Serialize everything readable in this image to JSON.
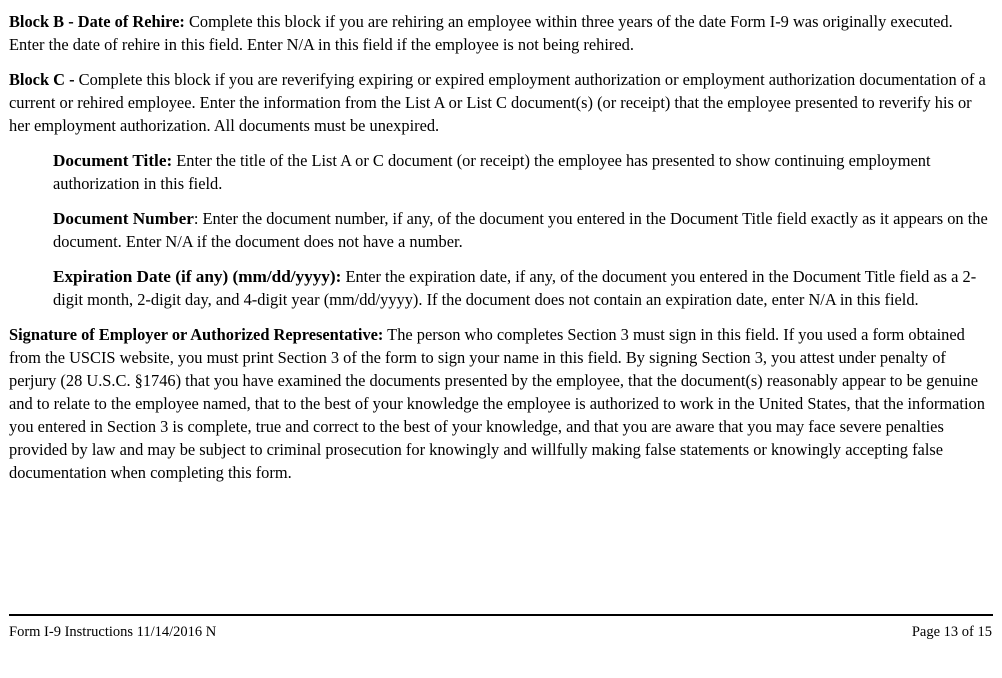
{
  "blocks": {
    "block_b": {
      "heading": "Block B - Date of Rehire:",
      "text": " Complete this block if you are rehiring an employee within three years of the date Form I-9 was originally executed. Enter the date of rehire in this field. Enter N/A in this field if the employee is not being rehired."
    },
    "block_c": {
      "heading": "Block C -",
      "text": " Complete this block if you are reverifying expiring or expired employment authorization or employment authorization documentation of a current or rehired employee. Enter the information from the List A or List C document(s) (or receipt) that the employee presented to reverify his or her employment authorization. All documents must be unexpired."
    },
    "document_title": {
      "heading": "Document Title:",
      "text": " Enter the title of the List A or C document (or receipt) the employee has presented to show continuing employment authorization in this field."
    },
    "document_number": {
      "heading": "Document Number",
      "text": ": Enter the document number, if any, of the document you entered in the Document Title field exactly as it appears on the document. Enter N/A if the document does not have a number."
    },
    "expiration_date": {
      "heading": "Expiration Date (if any) (mm/dd/yyyy):",
      "text": " Enter the expiration date, if any, of the document you entered in the Document Title field as a 2-digit month, 2-digit day, and 4-digit year (mm/dd/yyyy). If the document does not contain an expiration date, enter N/A in this field."
    },
    "signature": {
      "heading": "Signature of Employer or Authorized Representative:",
      "text": " The person who completes Section 3 must sign in this field. If you used a form obtained from the USCIS website, you must print Section 3 of the form to sign your name in this field. By signing Section 3, you attest under penalty of perjury (28 U.S.C. §1746) that you have examined the documents presented by the employee, that the document(s) reasonably appear to be genuine and to relate to the employee named, that to the best of your knowledge the employee is authorized to work in the United States, that the information you entered in Section 3 is complete, true and correct to the best of your knowledge, and that you are aware that you may face severe penalties provided by law and may be subject to criminal prosecution for knowingly and willfully making false statements or knowingly accepting false documentation when completing this form."
    }
  },
  "footer": {
    "form_label": "Form I-9 Instructions 11/14/2016 N",
    "page_label": "Page 13 of 15"
  }
}
